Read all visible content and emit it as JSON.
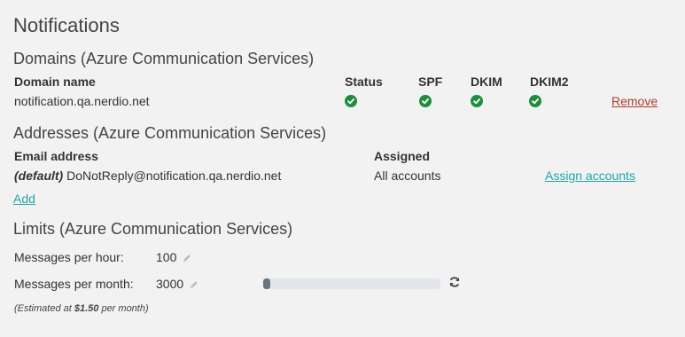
{
  "title": "Notifications",
  "domains": {
    "heading": "Domains (Azure Communication Services)",
    "headers": {
      "domain": "Domain name",
      "status": "Status",
      "spf": "SPF",
      "dkim": "DKIM",
      "dkim2": "DKIM2"
    },
    "rows": [
      {
        "domain": "notification.qa.nerdio.net",
        "status": "ok",
        "spf": "ok",
        "dkim": "ok",
        "dkim2": "ok",
        "action": "Remove"
      }
    ]
  },
  "addresses": {
    "heading": "Addresses (Azure Communication Services)",
    "headers": {
      "email": "Email address",
      "assigned": "Assigned"
    },
    "rows": [
      {
        "default_tag": "(default)",
        "email": "DoNotReply@notification.qa.nerdio.net",
        "assigned": "All accounts",
        "action": "Assign accounts"
      }
    ],
    "add_label": "Add"
  },
  "limits": {
    "heading": "Limits (Azure Communication Services)",
    "per_hour_label": "Messages per hour:",
    "per_hour_value": "100",
    "per_month_label": "Messages per month:",
    "per_month_value": "3000",
    "month_usage_fraction": 0.04,
    "estimate_prefix": "(Estimated at ",
    "estimate_amount": "$1.50",
    "estimate_suffix": " per month)"
  },
  "colors": {
    "check": "#1e8e3e",
    "remove": "#b03a2e",
    "link": "#1fa6a8",
    "progress_fill": "#6c757d",
    "progress_track": "#e2e6ea"
  },
  "icons": {
    "status_ok": "check-circle-icon",
    "edit": "pencil-icon",
    "refresh": "refresh-icon"
  }
}
